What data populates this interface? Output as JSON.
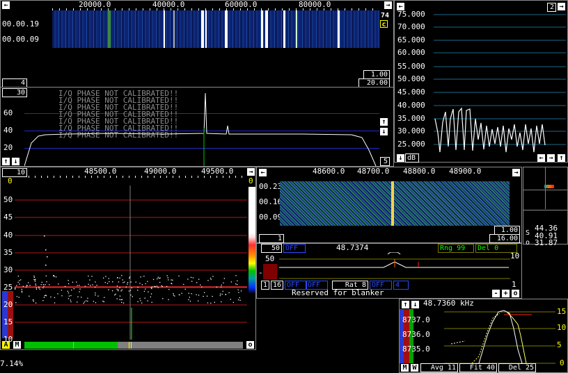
{
  "wide_waterfall": {
    "freq_labels": [
      "20000.0",
      "40000.0",
      "60000.0",
      "80000.0"
    ],
    "time_labels": [
      "00.00.19",
      "00.00.09"
    ],
    "count": "74",
    "mode": "c",
    "left_box": "4",
    "zoom": "1.00",
    "range": "20.00"
  },
  "wide_spectrum": {
    "scale_box": "30",
    "y_labels": [
      "60",
      "40",
      "20"
    ],
    "phase_warning": "I/Q PHASE NOT CALIBRATED!!",
    "bottom_box": "5"
  },
  "s_meter": {
    "box": "2",
    "y_labels": [
      "75.000",
      "70.000",
      "65.000",
      "60.000",
      "55.000",
      "50.000",
      "45.000",
      "40.000",
      "35.000",
      "30.000",
      "25.000"
    ],
    "unit": "dB"
  },
  "baseband_waterfall": {
    "freq_labels": [
      "48600.0",
      "48700.0",
      "48800.0",
      "48900.0"
    ],
    "time_labels": [
      "00.23",
      "00.16",
      "00.09"
    ],
    "left_box": "1",
    "zoom": "1.00",
    "range": "16.00"
  },
  "baseband_controls": {
    "bw_box": "50",
    "off1": "OFF",
    "freq": "48.7374",
    "rng": "Rng 99",
    "del": "Del  0",
    "scale_left": "50",
    "scale_right": "10",
    "marker": "-",
    "b1": "1",
    "b16": "16",
    "off2": "OFF",
    "off3": "OFF",
    "rat": "Rat  8",
    "off4": "OFF",
    "val4": "4",
    "right_num": "1",
    "blanker": "Reserved for blanker",
    "minus": "-",
    "plus": "+"
  },
  "hires": {
    "box": "10",
    "freq_labels": [
      "48500.0",
      "49000.0",
      "49500.0"
    ],
    "y_labels": [
      "50",
      "45",
      "40",
      "35",
      "30",
      "25",
      "20",
      "15",
      "10"
    ],
    "left_zero": "0",
    "right_zero": "0",
    "a": "A",
    "m": "M",
    "o": "o"
  },
  "polar": {
    "s": "44.36",
    "mid": "40.91",
    "o": "31.87",
    "s_lbl": "S",
    "o_lbl": "o"
  },
  "afc": {
    "freq": "48.7360 kHz",
    "y_labels": [
      "8737.0",
      "8736.0",
      "8735.0"
    ],
    "right_labels": [
      "15",
      "10",
      "5",
      "0"
    ],
    "m": "M",
    "w": "W",
    "avg": "Avg 11",
    "fit": "Fit 40",
    "del": "Del 25"
  },
  "footer": {
    "cpu": "7.14%"
  },
  "colors": {
    "grid_blue": "#1e2cc8",
    "grid_red": "#c81e1e",
    "grid_yellow": "#7a7a00",
    "white": "#ffffff"
  }
}
